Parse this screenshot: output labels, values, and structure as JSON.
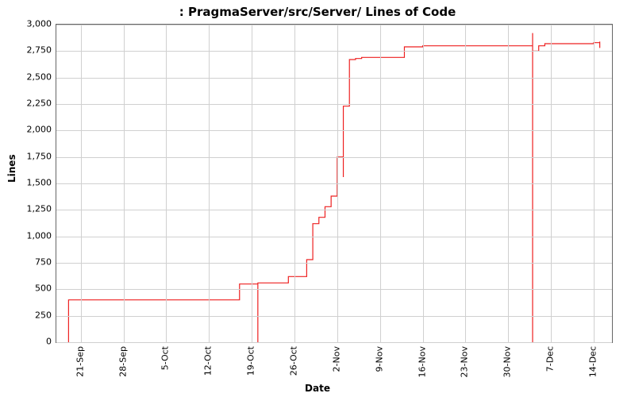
{
  "chart_data": {
    "type": "line",
    "title": ": PragmaServer/src/Server/ Lines of Code",
    "xlabel": "Date",
    "ylabel": "Lines",
    "ylim": [
      0,
      3000
    ],
    "xlim": [
      0,
      91
    ],
    "yticks": [
      0,
      250,
      500,
      750,
      1000,
      1250,
      1500,
      1750,
      2000,
      2250,
      2500,
      2750,
      3000
    ],
    "ytick_labels": [
      "0",
      "250",
      "500",
      "750",
      "1,000",
      "1,250",
      "1,500",
      "1,750",
      "2,000",
      "2,250",
      "2,500",
      "2,750",
      "3,000"
    ],
    "xticks": [
      4,
      11,
      18,
      25,
      32,
      39,
      46,
      53,
      60,
      67,
      74,
      81,
      88
    ],
    "xtick_labels": [
      "21-Sep",
      "28-Sep",
      "5-Oct",
      "12-Oct",
      "19-Oct",
      "26-Oct",
      "2-Nov",
      "9-Nov",
      "16-Nov",
      "23-Nov",
      "30-Nov",
      "7-Dec",
      "14-Dec"
    ],
    "series": [
      {
        "name": "Lines of Code",
        "color": "#ee2020",
        "x": [
          2,
          2,
          30,
          30,
          33,
          33,
          33,
          34,
          38,
          38,
          41,
          41,
          42,
          42,
          43,
          43,
          44,
          44,
          45,
          45,
          46,
          46,
          47,
          47,
          47,
          48,
          48,
          49,
          49,
          50,
          50,
          57,
          57,
          60,
          60,
          78,
          78,
          78,
          78,
          79,
          79,
          80,
          80,
          88,
          88,
          89,
          89,
          89
        ],
        "y": [
          0,
          400,
          400,
          550,
          550,
          0,
          560,
          560,
          560,
          620,
          620,
          780,
          780,
          1120,
          1120,
          1180,
          1180,
          1280,
          1280,
          1380,
          1380,
          1750,
          1750,
          1560,
          2230,
          2230,
          2670,
          2670,
          2680,
          2680,
          2690,
          2690,
          2790,
          2790,
          2800,
          2800,
          2920,
          0,
          2750,
          2750,
          2800,
          2800,
          2820,
          2820,
          2830,
          2830,
          2780,
          2840
        ]
      }
    ]
  }
}
